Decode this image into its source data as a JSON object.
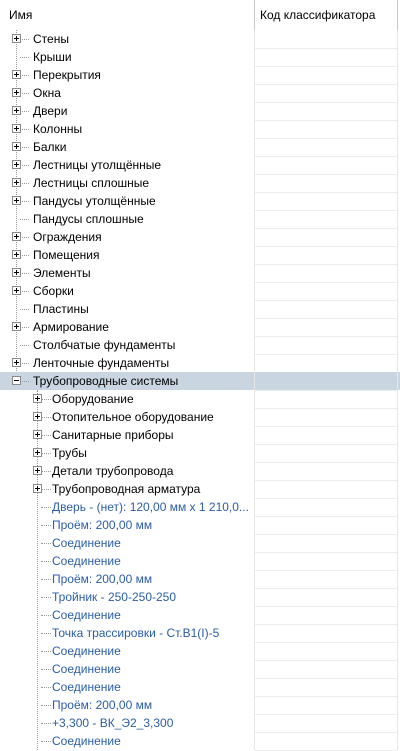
{
  "header": {
    "name_col": "Имя",
    "code_col": "Код классификатора"
  },
  "root_items": [
    {
      "label": "Стены",
      "expandable": true
    },
    {
      "label": "Крыши",
      "expandable": false
    },
    {
      "label": "Перекрытия",
      "expandable": true
    },
    {
      "label": "Окна",
      "expandable": true
    },
    {
      "label": "Двери",
      "expandable": true
    },
    {
      "label": "Колонны",
      "expandable": true
    },
    {
      "label": "Балки",
      "expandable": true
    },
    {
      "label": "Лестницы утолщённые",
      "expandable": true
    },
    {
      "label": "Лестницы сплошные",
      "expandable": true
    },
    {
      "label": "Пандусы утолщённые",
      "expandable": true
    },
    {
      "label": "Пандусы сплошные",
      "expandable": false
    },
    {
      "label": "Ограждения",
      "expandable": true
    },
    {
      "label": "Помещения",
      "expandable": true
    },
    {
      "label": "Элементы",
      "expandable": true
    },
    {
      "label": "Сборки",
      "expandable": true
    },
    {
      "label": "Пластины",
      "expandable": false
    },
    {
      "label": "Армирование",
      "expandable": true
    },
    {
      "label": "Столбчатые фундаменты",
      "expandable": false
    },
    {
      "label": "Ленточные фундаменты",
      "expandable": true
    },
    {
      "label": "Трубопроводные системы",
      "expandable": true,
      "expanded": true,
      "selected": true
    }
  ],
  "children": [
    {
      "label": "Оборудование",
      "expandable": true
    },
    {
      "label": "Отопительное оборудование",
      "expandable": true
    },
    {
      "label": "Санитарные приборы",
      "expandable": true
    },
    {
      "label": "Трубы",
      "expandable": true
    },
    {
      "label": "Детали трубопровода",
      "expandable": true
    },
    {
      "label": "Трубопроводная арматура",
      "expandable": true
    },
    {
      "label": "Дверь - (нет): 120,00 мм x 1 210,0...",
      "expandable": false,
      "link": true
    },
    {
      "label": "Проём: 200,00 мм",
      "expandable": false,
      "link": true
    },
    {
      "label": "Соединение",
      "expandable": false,
      "link": true
    },
    {
      "label": "Соединение",
      "expandable": false,
      "link": true
    },
    {
      "label": "Проём: 200,00 мм",
      "expandable": false,
      "link": true
    },
    {
      "label": "Тройник - 250-250-250",
      "expandable": false,
      "link": true
    },
    {
      "label": "Соединение",
      "expandable": false,
      "link": true
    },
    {
      "label": "Точка трассировки - Ст.В1(I)-5",
      "expandable": false,
      "link": true
    },
    {
      "label": "Соединение",
      "expandable": false,
      "link": true
    },
    {
      "label": "Соединение",
      "expandable": false,
      "link": true
    },
    {
      "label": "Соединение",
      "expandable": false,
      "link": true
    },
    {
      "label": "Проём: 200,00 мм",
      "expandable": false,
      "link": true
    },
    {
      "label": "+3,300 - ВК_Э2_3,300",
      "expandable": false,
      "link": true
    },
    {
      "label": "Соединение",
      "expandable": false,
      "link": true
    }
  ]
}
